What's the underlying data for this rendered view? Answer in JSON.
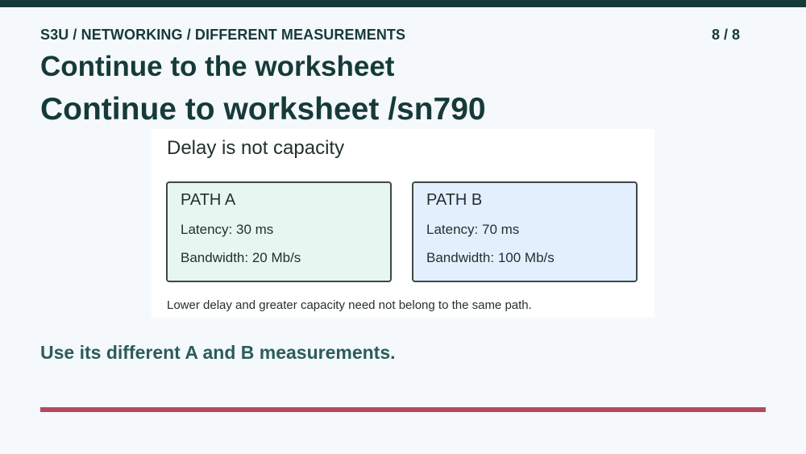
{
  "header": {
    "breadcrumb": "S3U / NETWORKING / DIFFERENT MEASUREMENTS",
    "page_counter": "8 / 8"
  },
  "title": "Continue to the worksheet",
  "subtitle": "Continue to worksheet /sn790",
  "panel": {
    "title": "Delay is not capacity",
    "paths": [
      {
        "name": "PATH A",
        "latency": "Latency: 30 ms",
        "bandwidth": "Bandwidth: 20 Mb/s",
        "color": "#e6f6f0"
      },
      {
        "name": "PATH B",
        "latency": "Latency: 70 ms",
        "bandwidth": "Bandwidth: 100 Mb/s",
        "color": "#e3effd"
      }
    ],
    "note": "Lower delay and greater capacity need not belong to the same path."
  },
  "footer": {
    "text": "Use its different A and B measurements."
  },
  "colors": {
    "top_bar": "#163a3a",
    "accent_bar": "#b44a5e",
    "footer_text": "#2b5c5c"
  }
}
